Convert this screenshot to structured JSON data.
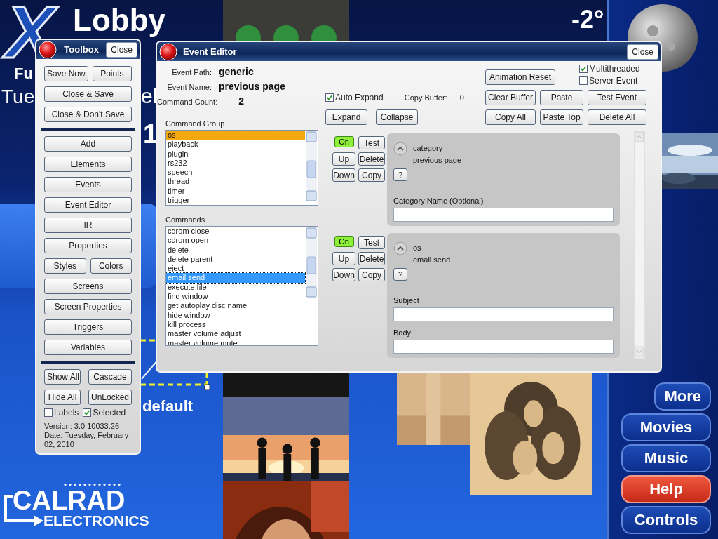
{
  "background": {
    "logo": {
      "mark": "X",
      "name": "Lobby"
    },
    "temperature": "-2°",
    "fragments": [
      "Fu",
      "Tue",
      "el",
      "1",
      "default"
    ],
    "brand": {
      "name": "CALRAD",
      "subtitle": "ELECTRONICS"
    },
    "nav": [
      {
        "label": "More",
        "selected": false
      },
      {
        "label": "Movies",
        "selected": false
      },
      {
        "label": "Music",
        "selected": false
      },
      {
        "label": "Help",
        "selected": true
      },
      {
        "label": "Controls",
        "selected": false
      }
    ]
  },
  "toolbox": {
    "title": "Toolbox",
    "close": "Close",
    "sections": [
      [
        [
          "Save Now",
          "Points"
        ],
        [
          "Close & Save"
        ],
        [
          "Close & Don't Save"
        ]
      ],
      [
        [
          "Add"
        ],
        [
          "Elements"
        ],
        [
          "Events"
        ],
        [
          "Event Editor"
        ],
        [
          "IR"
        ],
        [
          "Properties"
        ],
        [
          "Styles",
          "Colors"
        ],
        [
          "Screens"
        ],
        [
          "Screen Properties"
        ],
        [
          "Triggers"
        ],
        [
          "Variables"
        ]
      ],
      [
        [
          "Show All",
          "Cascade"
        ],
        [
          "Hide All",
          "UnLocked"
        ]
      ]
    ],
    "checkboxes": [
      {
        "label": "Labels",
        "checked": false
      },
      {
        "label": "Selected",
        "checked": true
      }
    ],
    "version": "Version: 3.0.10033.26",
    "date": "Date: Tuesday, February 02, 2010"
  },
  "event_editor": {
    "title": "Event Editor",
    "close": "Close",
    "info": [
      {
        "label": "Event Path:",
        "value": "generic"
      },
      {
        "label": "Event Name:",
        "value": "previous page"
      }
    ],
    "command_count": {
      "label": "Command Count:",
      "value": "2"
    },
    "command_group": {
      "label": "Command Group",
      "items": [
        {
          "text": "os",
          "selected": true
        },
        {
          "text": "playback",
          "selected": false
        },
        {
          "text": "plugin",
          "selected": false
        },
        {
          "text": "rs232",
          "selected": false
        },
        {
          "text": "speech",
          "selected": false
        },
        {
          "text": "thread",
          "selected": false
        },
        {
          "text": "timer",
          "selected": false
        },
        {
          "text": "trigger",
          "selected": false
        }
      ]
    },
    "commands_list": {
      "label": "Commands",
      "items": [
        {
          "text": "cdrom close",
          "selected": false
        },
        {
          "text": "cdrom open",
          "selected": false
        },
        {
          "text": "delete",
          "selected": false
        },
        {
          "text": "delete parent",
          "selected": false
        },
        {
          "text": "eject",
          "selected": false
        },
        {
          "text": "email send",
          "selected": true
        },
        {
          "text": "execute file",
          "selected": false
        },
        {
          "text": "find window",
          "selected": false
        },
        {
          "text": "get autoplay disc name",
          "selected": false
        },
        {
          "text": "hide window",
          "selected": false
        },
        {
          "text": "kill process",
          "selected": false
        },
        {
          "text": "master volume adjust",
          "selected": false
        },
        {
          "text": "master volume mute",
          "selected": false
        }
      ]
    },
    "animation_reset": "Animation Reset",
    "options": [
      {
        "label": "Multithreaded",
        "checked": true
      },
      {
        "label": "Server Event",
        "checked": false
      }
    ],
    "auto_expand": {
      "label": "Auto Expand",
      "checked": true
    },
    "copy_buffer": {
      "label": "Copy Buffer:",
      "value": "0"
    },
    "expand_buttons": [
      "Expand",
      "Collapse"
    ],
    "buffer_buttons": [
      [
        "Clear Buffer",
        "Paste",
        "Test Event"
      ],
      [
        "Copy All",
        "Paste Top",
        "Delete All"
      ]
    ],
    "commands": [
      {
        "on": true,
        "on_label": "On",
        "buttons": [
          "Test",
          "Up",
          "Delete",
          "Down",
          "Copy"
        ],
        "group": "category",
        "name": "previous page",
        "help": "?",
        "fields": [
          {
            "label": "Category Name (Optional)"
          }
        ]
      },
      {
        "on": true,
        "on_label": "On",
        "buttons": [
          "Test",
          "Up",
          "Delete",
          "Down",
          "Copy"
        ],
        "group": "os",
        "name": "email send",
        "help": "?",
        "fields": [
          {
            "label": "Subject"
          },
          {
            "label": "Body"
          }
        ]
      }
    ]
  }
}
